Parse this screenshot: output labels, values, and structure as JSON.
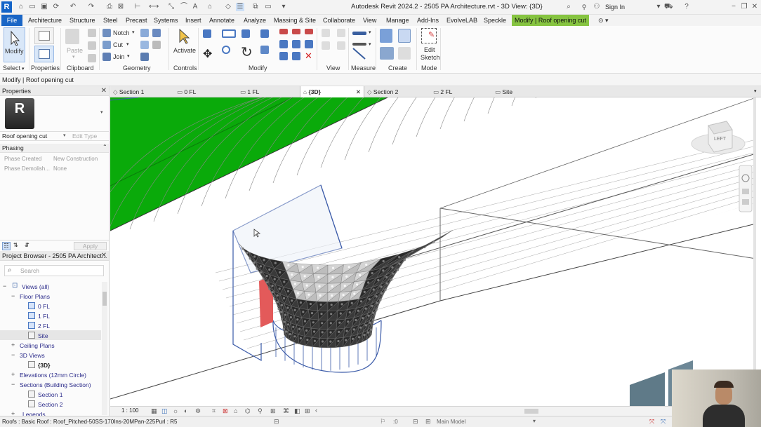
{
  "app": {
    "logo_letter": "R",
    "title": "Autodesk Revit 2024.2 - 2505 PA Architecture.rvt - 3D View: {3D}",
    "sign_in": "Sign In"
  },
  "ribbon_tabs": [
    "File",
    "Architecture",
    "Structure",
    "Steel",
    "Precast",
    "Systems",
    "Insert",
    "Annotate",
    "Analyze",
    "Massing & Site",
    "Collaborate",
    "View",
    "Manage",
    "Add-Ins",
    "EvolveLAB",
    "Speckle",
    "Modify | Roof opening cut"
  ],
  "ribbon": {
    "modify_label": "Modify",
    "paste_label": "Paste",
    "notch_label": "Notch",
    "cut_label": "Cut",
    "join_label": "Join",
    "activate_label": "Activate",
    "edit_sketch_label": "Edit\nSketch",
    "edit_label": "Edit",
    "sketch_label": "Sketch",
    "panels": {
      "select": "Select",
      "properties": "Properties",
      "clipboard": "Clipboard",
      "geometry": "Geometry",
      "controls": "Controls",
      "modify": "Modify",
      "view": "View",
      "measure": "Measure",
      "create": "Create",
      "mode": "Mode"
    }
  },
  "options_bar": {
    "text": "Modify | Roof opening cut"
  },
  "properties": {
    "header": "Properties",
    "type_letter": "R",
    "type_selector": "Roof opening cut",
    "edit_type": "Edit Type",
    "group": "Phasing",
    "rows": [
      {
        "label": "Phase Created",
        "value": "New Construction"
      },
      {
        "label": "Phase Demolish...",
        "value": "None"
      }
    ],
    "apply": "Apply"
  },
  "project_browser": {
    "header": "Project Browser - 2505 PA Architect...",
    "search_placeholder": "Search",
    "items": [
      {
        "label": "Views (all)",
        "toggle": "−"
      },
      {
        "label": "Floor Plans",
        "toggle": "−"
      },
      {
        "label": "0 FL",
        "toggle": ""
      },
      {
        "label": "1 FL",
        "toggle": ""
      },
      {
        "label": "2 FL",
        "toggle": ""
      },
      {
        "label": "Site",
        "toggle": ""
      },
      {
        "label": "Ceiling Plans",
        "toggle": "+"
      },
      {
        "label": "3D Views",
        "toggle": "−"
      },
      {
        "label": "{3D}",
        "toggle": ""
      },
      {
        "label": "Elevations (12mm Circle)",
        "toggle": "+"
      },
      {
        "label": "Sections (Building Section)",
        "toggle": "−"
      },
      {
        "label": "Section 1",
        "toggle": ""
      },
      {
        "label": "Section 2",
        "toggle": ""
      },
      {
        "label": "Legends",
        "toggle": "+"
      }
    ]
  },
  "view_tabs": [
    "Section 1",
    "0 FL",
    "1 FL",
    "{3D}",
    "Section 2",
    "2 FL",
    "Site"
  ],
  "viewcube": {
    "face": "LEFT"
  },
  "view_control": {
    "scale": "1 : 100"
  },
  "status_bar": {
    "text": "Roofs : Basic Roof : Roof_Pitched-50SS-170Ins-20MPan-225Purl : R5",
    "zero": ":0",
    "model": "Main Model"
  },
  "colors": {
    "accent": "#1a66c6",
    "context_tab": "#86c441",
    "green_surface": "#0aaa0a",
    "mesh_dark": "#2a2a2a",
    "mesh_light": "#cfcfcf",
    "cut_outline": "#3a5aa8",
    "red_face": "#e35a5a"
  }
}
